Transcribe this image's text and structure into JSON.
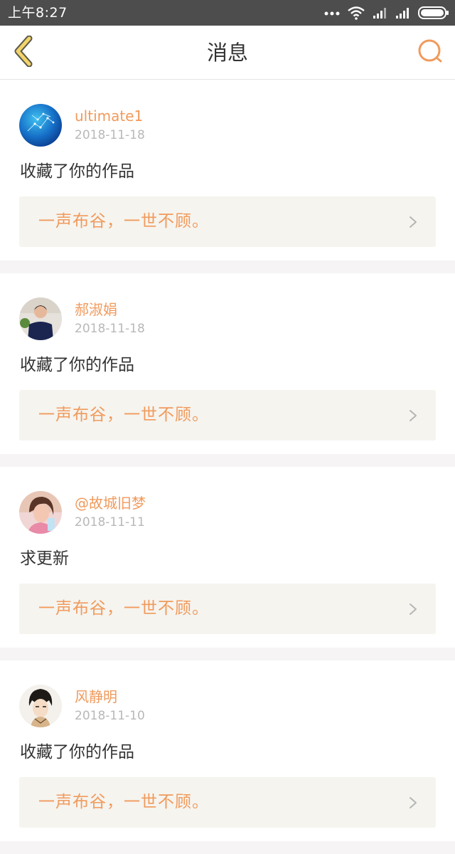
{
  "status_bar": {
    "time": "上午8:27",
    "icons": [
      "more-dots-icon",
      "wifi-icon",
      "signal-icon",
      "signal-icon",
      "battery-icon"
    ]
  },
  "header": {
    "title": "消息",
    "back_icon": "chevron-left-icon",
    "search_icon": "search-icon"
  },
  "colors": {
    "accent": "#f19a5c",
    "back_icon_fill": "#f3d36a",
    "back_icon_stroke": "#5a5a4a",
    "card_link_bg": "#f5f4ef"
  },
  "messages": [
    {
      "user": "ultimate1",
      "date": "2018-11-18",
      "text": "收藏了你的作品",
      "work": "一声布谷，一世不顾。"
    },
    {
      "user": "郝淑娟",
      "date": "2018-11-18",
      "text": "收藏了你的作品",
      "work": "一声布谷，一世不顾。"
    },
    {
      "user": "@故城旧梦",
      "date": "2018-11-11",
      "text": "求更新",
      "work": "一声布谷，一世不顾。"
    },
    {
      "user": "风静明",
      "date": "2018-11-10",
      "text": "收藏了你的作品",
      "work": "一声布谷，一世不顾。"
    }
  ]
}
